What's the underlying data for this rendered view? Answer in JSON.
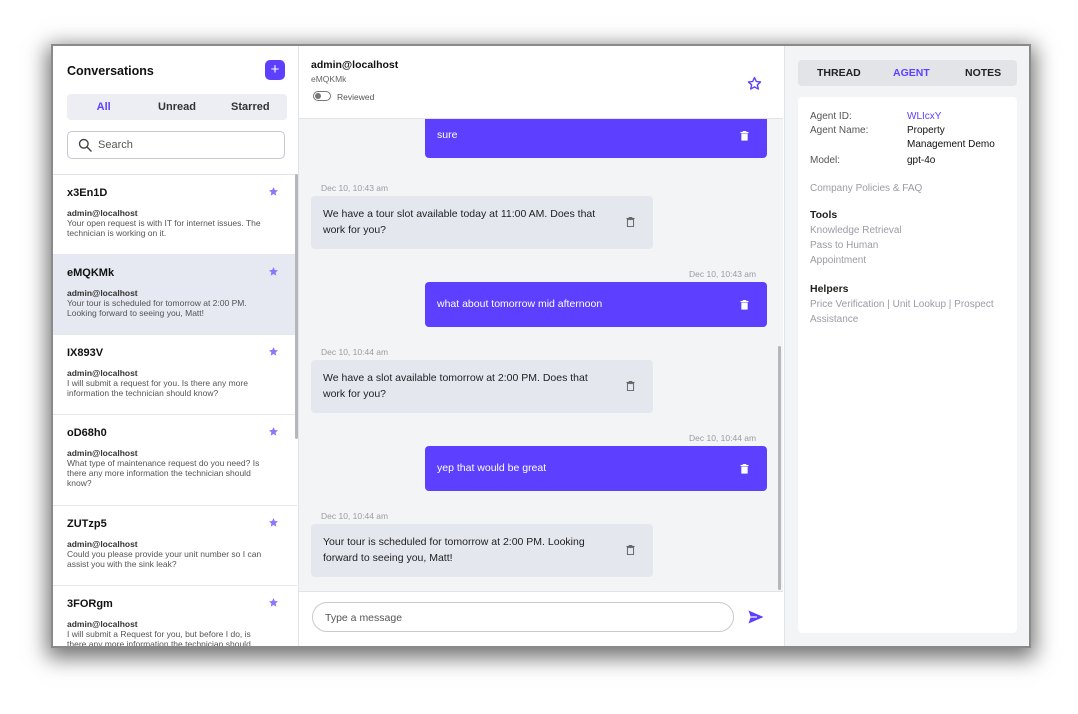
{
  "conversations": {
    "title": "Conversations",
    "add_label": "+",
    "filters": [
      "All",
      "Unread",
      "Starred"
    ],
    "search_placeholder": "Search",
    "items": [
      {
        "id": "x3En1D",
        "user": "admin@localhost",
        "preview": "Your open request is with IT for internet issues. The technician is working on it."
      },
      {
        "id": "eMQKMk",
        "user": "admin@localhost",
        "preview": "Your tour is scheduled for tomorrow at 2:00 PM. Looking forward to seeing you, Matt!"
      },
      {
        "id": "IX893V",
        "user": "admin@localhost",
        "preview": "I will submit a request for you. Is there any more information the technician should know?"
      },
      {
        "id": "oD68h0",
        "user": "admin@localhost",
        "preview": "What type of maintenance request do you need? Is there any more information the technician should know?"
      },
      {
        "id": "ZUTzp5",
        "user": "admin@localhost",
        "preview": "Could you please provide your unit number so I can assist you with the sink leak?"
      },
      {
        "id": "3FORgm",
        "user": "admin@localhost",
        "preview": "I will submit a Request for you, but before I do, is there any more information the technician should"
      }
    ]
  },
  "thread": {
    "title": "admin@localhost",
    "subtitle": "eMQKMk",
    "reviewed_label": "Reviewed",
    "messages": [
      {
        "role": "user",
        "text": "sure",
        "time": ""
      },
      {
        "role": "bot",
        "time": "Dec 10, 10:43 am",
        "lines": [
          "We have a tour slot available today at 11:00 AM. Does that",
          "work for you?"
        ]
      },
      {
        "role": "user",
        "time": "Dec 10, 10:43 am",
        "text": "what about tomorrow mid afternoon"
      },
      {
        "role": "bot",
        "time": "Dec 10, 10:44 am",
        "lines": [
          "We have a slot available tomorrow at 2:00 PM. Does that",
          "work for you?"
        ]
      },
      {
        "role": "user",
        "time": "Dec 10, 10:44 am",
        "text": "yep that would be great"
      },
      {
        "role": "bot",
        "time": "Dec 10, 10:44 am",
        "lines": [
          "Your tour is scheduled for tomorrow at 2:00 PM. Looking",
          "forward to seeing you, Matt!"
        ]
      }
    ],
    "composer_placeholder": "Type a message"
  },
  "details": {
    "tabs": [
      "THREAD",
      "AGENT",
      "NOTES"
    ],
    "active_tab": "AGENT",
    "agent_id_label": "Agent ID:",
    "agent_id": "WLIcxY",
    "agent_name_label": "Agent Name:",
    "agent_name_lines": [
      "Property",
      "Management Demo"
    ],
    "model_label": "Model:",
    "model": "gpt-4o",
    "policies": "Company Policies & FAQ",
    "tools_label": "Tools",
    "tools": [
      "Knowledge Retrieval",
      "Pass to Human",
      "Appointment"
    ],
    "helpers_label": "Helpers",
    "helpers_lines": [
      "Price Verification | Unit Lookup | Prospect",
      "Assistance"
    ]
  },
  "colors": {
    "accent": "#5d3fff",
    "bot_bubble": "#e5e7ef",
    "panel_bg": "#f3f4f6"
  }
}
